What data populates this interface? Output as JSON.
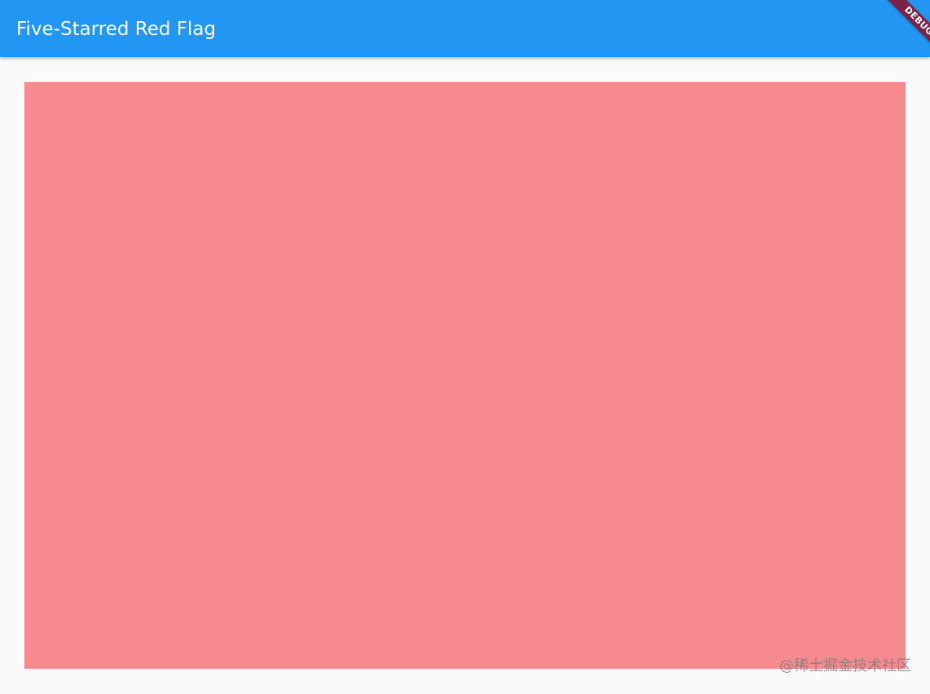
{
  "app_bar": {
    "title": "Five-Starred Red Flag",
    "color": "#2196f3"
  },
  "debug_banner": {
    "label": "DEBUG",
    "color": "#7b2246"
  },
  "flag": {
    "fill_color": "#f68a8f"
  },
  "watermark": {
    "text": "@稀土掘金技术社区"
  },
  "colors": {
    "background": "#fafafa",
    "title_text": "#ffffff"
  }
}
